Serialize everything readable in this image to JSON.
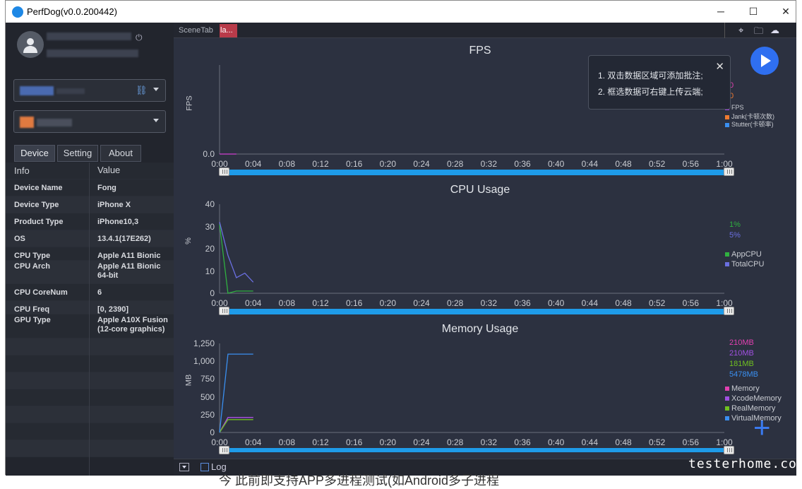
{
  "window": {
    "title": "PerfDog(v0.0.200442)",
    "minimize": "─",
    "maximize": "☐",
    "close": "✕"
  },
  "sidebar": {
    "power_icon": "power-icon",
    "tabs": [
      {
        "label": "Device"
      },
      {
        "label": "Setting"
      },
      {
        "label": "About"
      }
    ],
    "table_header": {
      "key": "Info",
      "value": "Value"
    },
    "rows": [
      {
        "key": "Device Name",
        "value": "Fong"
      },
      {
        "key": "Device Type",
        "value": "iPhone X"
      },
      {
        "key": "Product Type",
        "value": "iPhone10,3"
      },
      {
        "key": "OS",
        "value": "13.4.1(17E262)"
      },
      {
        "key": "CPU Type",
        "value": "Apple A11 Bionic"
      },
      {
        "key": "CPU Arch",
        "value": "Apple A11 Bionic 64-bit"
      },
      {
        "key": "CPU CoreNum",
        "value": "6"
      },
      {
        "key": "CPU Freq",
        "value": "[0, 2390]"
      },
      {
        "key": "GPU Type",
        "value": "Apple A10X Fusion (12-core graphics)"
      }
    ]
  },
  "topbar": {
    "scene_tab": "SceneTab",
    "active_tab": "la..."
  },
  "tooltip": {
    "line1": "1. 双击数据区域可添加批注;",
    "line2": "2. 框选数据可右键上传云端;"
  },
  "x_ticks": [
    "0:00",
    "0:04",
    "0:08",
    "0:12",
    "0:16",
    "0:20",
    "0:24",
    "0:28",
    "0:32",
    "0:36",
    "0:40",
    "0:44",
    "0:48",
    "0:52",
    "0:56",
    "1:00"
  ],
  "charts": {
    "fps": {
      "title": "FPS",
      "ylabel": "FPS",
      "yticks": [
        "0.0"
      ],
      "values_shown": [
        "0",
        "0"
      ],
      "legend": [
        {
          "name": "FPS",
          "color": "#a040e0"
        },
        {
          "name": "Jank(卡顿次数)",
          "color": "#f07a30"
        },
        {
          "name": "Stutter(卡顿率)",
          "color": "#3a8ff0"
        }
      ]
    },
    "cpu": {
      "title": "CPU Usage",
      "ylabel": "%",
      "yticks": [
        "40",
        "30",
        "20",
        "10",
        "0"
      ],
      "values_shown": [
        "1%",
        "5%"
      ],
      "legend": [
        {
          "name": "AppCPU",
          "color": "#30b040"
        },
        {
          "name": "TotalCPU",
          "color": "#6a6fe0"
        }
      ]
    },
    "memory": {
      "title": "Memory Usage",
      "ylabel": "MB",
      "yticks": [
        "1,250",
        "1,000",
        "750",
        "500",
        "250",
        "0"
      ],
      "values_shown": [
        "210MB",
        "210MB",
        "181MB",
        "5478MB"
      ],
      "legend": [
        {
          "name": "Memory",
          "color": "#e040b0"
        },
        {
          "name": "XcodeMemory",
          "color": "#a050e0"
        },
        {
          "name": "RealMemory",
          "color": "#70c020"
        },
        {
          "name": "VirtualMemory",
          "color": "#3a8ff0"
        }
      ]
    }
  },
  "chart_data": [
    {
      "type": "line",
      "title": "FPS",
      "ylabel": "FPS",
      "ylim": [
        0,
        1
      ],
      "x": [
        "0:00",
        "0:01",
        "0:02"
      ],
      "series": [
        {
          "name": "FPS",
          "values": [
            0,
            0,
            0
          ]
        }
      ]
    },
    {
      "type": "line",
      "title": "CPU Usage",
      "ylabel": "%",
      "ylim": [
        0,
        40
      ],
      "x": [
        "0:00",
        "0:01",
        "0:02",
        "0:03",
        "0:04"
      ],
      "series": [
        {
          "name": "AppCPU",
          "values": [
            31,
            0,
            1,
            1,
            1
          ]
        },
        {
          "name": "TotalCPU",
          "values": [
            32,
            17,
            7,
            9,
            5
          ]
        }
      ]
    },
    {
      "type": "line",
      "title": "Memory Usage",
      "ylabel": "MB",
      "ylim": [
        0,
        1250
      ],
      "x": [
        "0:00",
        "0:01",
        "0:02",
        "0:03",
        "0:04"
      ],
      "series": [
        {
          "name": "Memory",
          "values": [
            0,
            210,
            210,
            210,
            210
          ]
        },
        {
          "name": "XcodeMemory",
          "values": [
            0,
            210,
            210,
            210,
            210
          ]
        },
        {
          "name": "RealMemory",
          "values": [
            0,
            181,
            181,
            181,
            181
          ]
        },
        {
          "name": "VirtualMemory",
          "values": [
            0,
            1100,
            1100,
            1100,
            1100
          ]
        }
      ]
    }
  ],
  "bottombar": {
    "log_label": "Log"
  },
  "watermark": "testerhome.com",
  "background_text": "今  此前即支持APP多进程测试(如Android多子进程"
}
